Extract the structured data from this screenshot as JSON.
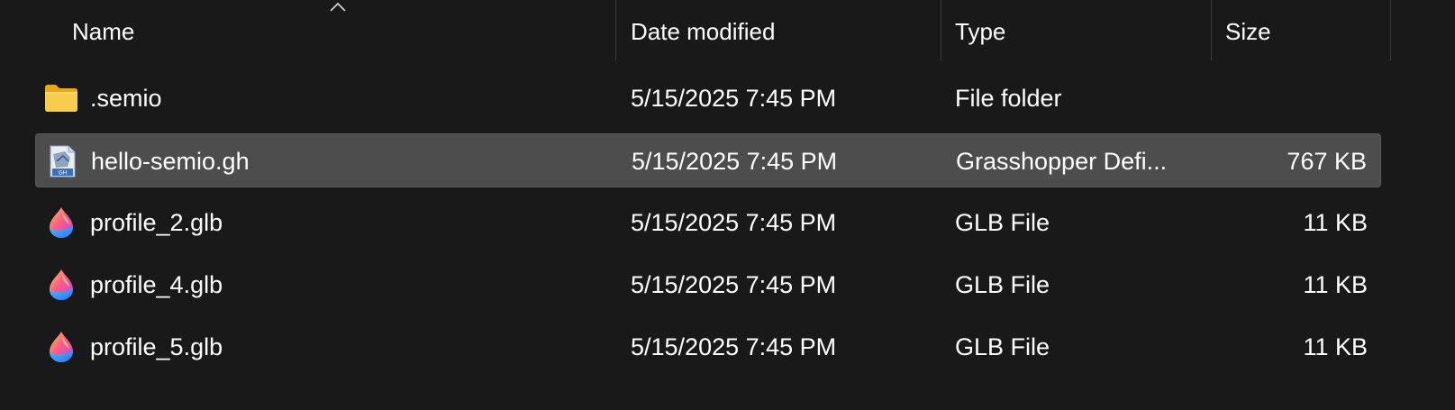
{
  "columns": {
    "name": "Name",
    "date": "Date modified",
    "type": "Type",
    "size": "Size",
    "sort": "ascending"
  },
  "files": [
    {
      "name": ".semio",
      "date": "5/15/2025 7:45 PM",
      "type": "File folder",
      "size": "",
      "icon": "folder-icon",
      "selected": false
    },
    {
      "name": "hello-semio.gh",
      "date": "5/15/2025 7:45 PM",
      "type": "Grasshopper Defi...",
      "size": "767 KB",
      "icon": "grasshopper-file-icon",
      "selected": true
    },
    {
      "name": "profile_2.glb",
      "date": "5/15/2025 7:45 PM",
      "type": "GLB File",
      "size": "11 KB",
      "icon": "glb-file-icon",
      "selected": false
    },
    {
      "name": "profile_4.glb",
      "date": "5/15/2025 7:45 PM",
      "type": "GLB File",
      "size": "11 KB",
      "icon": "glb-file-icon",
      "selected": false
    },
    {
      "name": "profile_5.glb",
      "date": "5/15/2025 7:45 PM",
      "type": "GLB File",
      "size": "11 KB",
      "icon": "glb-file-icon",
      "selected": false
    }
  ],
  "colors": {
    "background": "#191919",
    "selected_row": "#4d4d4d",
    "text": "#ffffff",
    "folder": "#f4c542"
  }
}
